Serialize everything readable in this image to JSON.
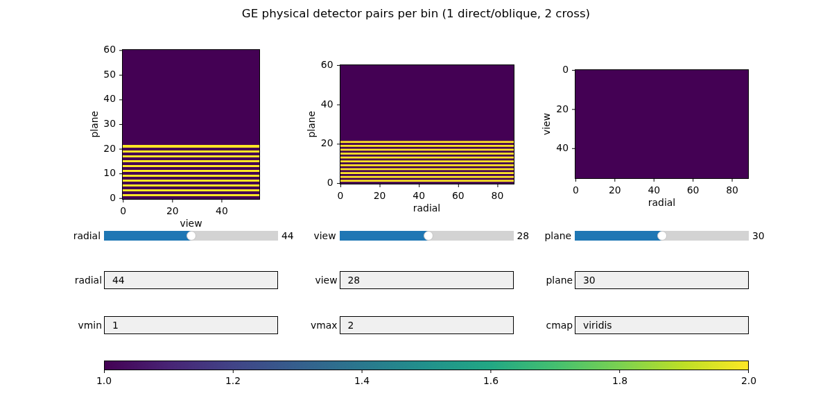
{
  "figure": {
    "title": "GE physical detector pairs per bin (1 direct/oblique, 2 cross)"
  },
  "plots": [
    {
      "kind": "striped",
      "ylabel": "plane",
      "yticks": [
        "60",
        "50",
        "40",
        "30",
        "20",
        "10",
        "0"
      ],
      "y_inverted": false,
      "xticks": [
        "0",
        "20",
        "40"
      ],
      "xlabel": "view"
    },
    {
      "kind": "striped",
      "ylabel": "plane",
      "yticks": [
        "60",
        "40",
        "20",
        "0"
      ],
      "y_inverted": false,
      "xticks": [
        "0",
        "20",
        "40",
        "60",
        "80"
      ],
      "xlabel": "radial"
    },
    {
      "kind": "uniform",
      "ylabel": "view",
      "yticks": [
        "0",
        "20",
        "40"
      ],
      "y_inverted": true,
      "xticks": [
        "0",
        "20",
        "40",
        "60",
        "80"
      ],
      "xlabel": "radial"
    }
  ],
  "sliders": [
    {
      "label": "radial",
      "level": 0.5,
      "reading": "44"
    },
    {
      "label": "view",
      "level": 0.51,
      "reading": "28"
    },
    {
      "label": "plane",
      "level": 0.5,
      "reading": "30"
    }
  ],
  "text_fields": [
    {
      "label": "radial",
      "value": "44"
    },
    {
      "label": "view",
      "value": "28"
    },
    {
      "label": "plane",
      "value": "30"
    },
    {
      "label": "vmin",
      "value": "1"
    },
    {
      "label": "vmax",
      "value": "2"
    },
    {
      "label": "cmap",
      "value": "viridis"
    }
  ],
  "colorbar": {
    "ticks": [
      "1.0",
      "1.2",
      "1.4",
      "1.6",
      "1.8",
      "2.0"
    ]
  }
}
